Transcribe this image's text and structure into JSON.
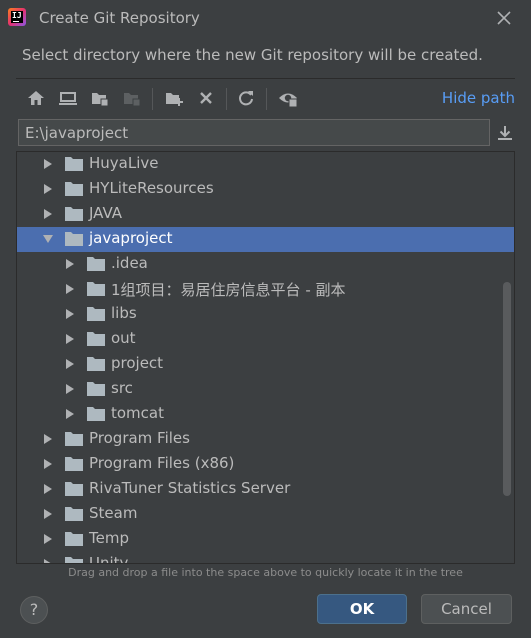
{
  "window": {
    "title": "Create Git Repository"
  },
  "subtitle": "Select directory where the new Git repository will be created.",
  "toolbar": {
    "icons": [
      "home-icon",
      "desktop-icon",
      "project-folder-icon",
      "module-folder-icon",
      "new-folder-icon",
      "delete-icon",
      "refresh-icon",
      "show-hidden-icon"
    ],
    "hide_path_label": "Hide path"
  },
  "path": {
    "value": "E:\\javaproject"
  },
  "tree": {
    "items": [
      {
        "label": "HuyaLive",
        "level": 0,
        "expanded": false,
        "selected": false
      },
      {
        "label": "HYLiteResources",
        "level": 0,
        "expanded": false,
        "selected": false
      },
      {
        "label": "JAVA",
        "level": 0,
        "expanded": false,
        "selected": false
      },
      {
        "label": "javaproject",
        "level": 0,
        "expanded": true,
        "selected": true
      },
      {
        "label": ".idea",
        "level": 1,
        "expanded": false,
        "selected": false
      },
      {
        "label": "1组项目：易居住房信息平台 - 副本",
        "level": 1,
        "expanded": false,
        "selected": false
      },
      {
        "label": "libs",
        "level": 1,
        "expanded": false,
        "selected": false
      },
      {
        "label": "out",
        "level": 1,
        "expanded": false,
        "selected": false
      },
      {
        "label": "project",
        "level": 1,
        "expanded": false,
        "selected": false
      },
      {
        "label": "src",
        "level": 1,
        "expanded": false,
        "selected": false
      },
      {
        "label": "tomcat",
        "level": 1,
        "expanded": false,
        "selected": false
      },
      {
        "label": "Program Files",
        "level": 0,
        "expanded": false,
        "selected": false
      },
      {
        "label": "Program Files (x86)",
        "level": 0,
        "expanded": false,
        "selected": false
      },
      {
        "label": "RivaTuner Statistics Server",
        "level": 0,
        "expanded": false,
        "selected": false
      },
      {
        "label": "Steam",
        "level": 0,
        "expanded": false,
        "selected": false
      },
      {
        "label": "Temp",
        "level": 0,
        "expanded": false,
        "selected": false
      },
      {
        "label": "Unity",
        "level": 0,
        "expanded": false,
        "selected": false
      }
    ]
  },
  "hint": "Drag and drop a file into the space above to quickly locate it in the tree",
  "buttons": {
    "help": "?",
    "ok": "OK",
    "cancel": "Cancel"
  },
  "colors": {
    "background": "#3c3f41",
    "selection": "#4b6eaf",
    "link": "#589df6",
    "ok_button": "#365880",
    "folder": "#aeb9c0"
  }
}
